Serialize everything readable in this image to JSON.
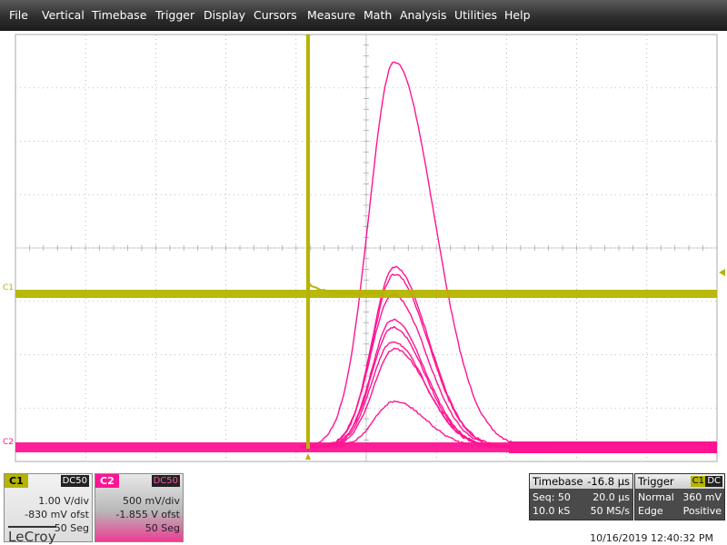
{
  "menu": [
    "File",
    "Vertical",
    "Timebase",
    "Trigger",
    "Display",
    "Cursors",
    "Measure",
    "Math",
    "Analysis",
    "Utilities",
    "Help"
  ],
  "colors": {
    "c1": "#b5b400",
    "c2": "#ff1493",
    "grid": "#a8a8a8",
    "panel": "#4a4a4a"
  },
  "markers": {
    "c1": "C1",
    "c2": "C2"
  },
  "channels": [
    {
      "label": "C1",
      "coupling": "DC50",
      "scale": "1.00 V/div",
      "offset": "-830 mV ofst",
      "segments": "50 Seg"
    },
    {
      "label": "C2",
      "coupling": "DC50",
      "scale": "500 mV/div",
      "offset": "-1.855 V ofst",
      "segments": "50 Seg"
    }
  ],
  "timebase": {
    "title": "Timebase",
    "delay": "-16.8 µs",
    "seq_label": "Seq: 50",
    "per_div": "20.0 µs",
    "samples": "10.0 kS",
    "rate": "50 MS/s"
  },
  "trigger": {
    "title": "Trigger",
    "source": "C1",
    "coupling": "DC",
    "mode": "Normal",
    "level": "360 mV",
    "type": "Edge",
    "slope": "Positive"
  },
  "brand": "LeCroy",
  "datetime": "10/16/2019 12:40:32 PM"
}
